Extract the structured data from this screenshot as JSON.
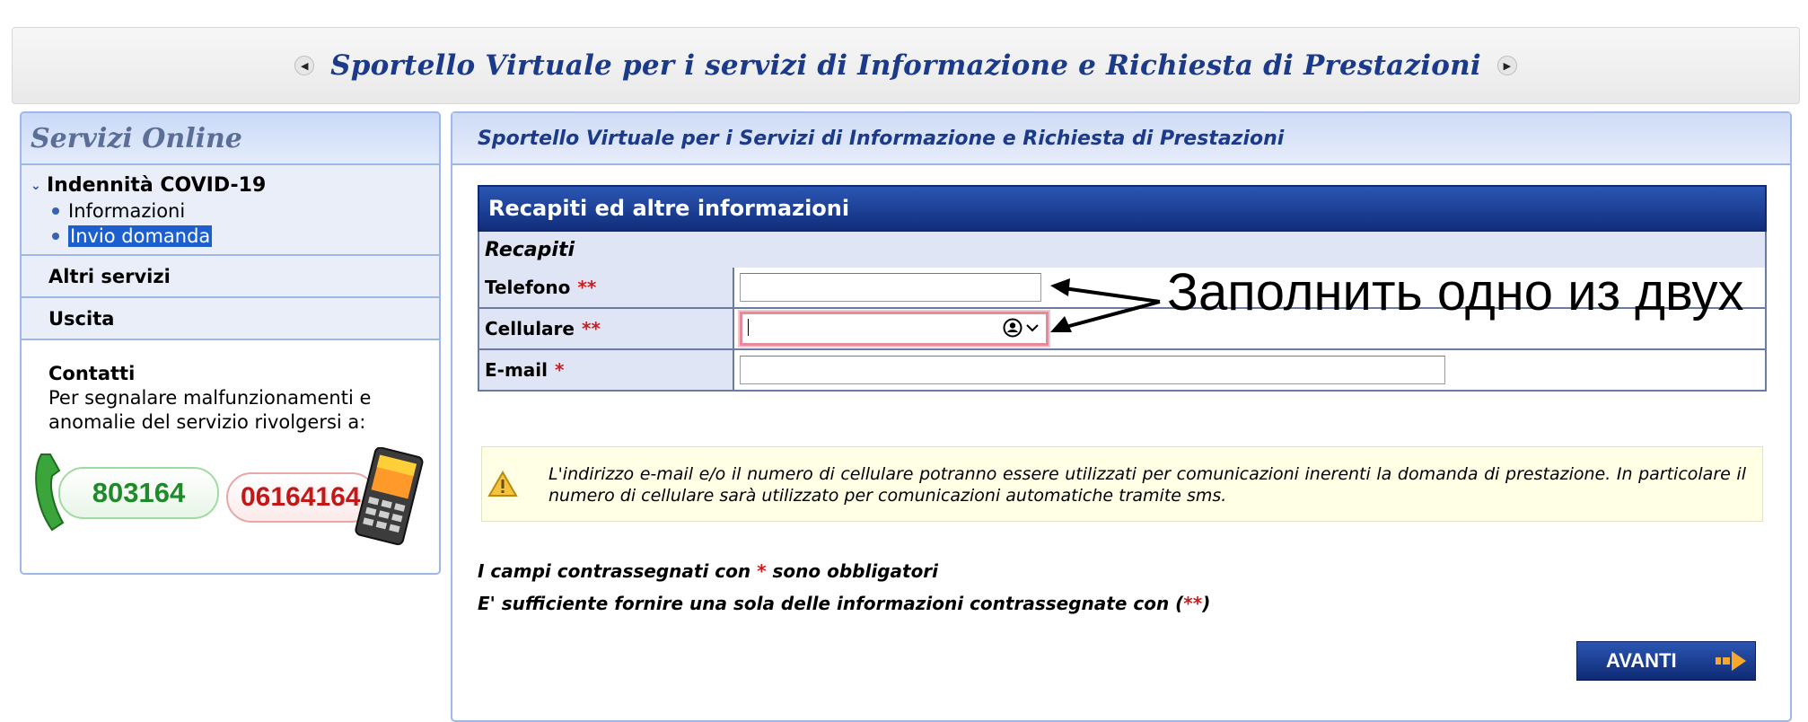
{
  "header": {
    "title": "Sportello Virtuale per i servizi di Informazione e Richiesta di Prestazioni",
    "prev_icon": "chevron-left-icon",
    "next_icon": "chevron-right-icon"
  },
  "sidebar": {
    "title": "Servizi Online",
    "group": {
      "label": "Indennità COVID-19",
      "items": [
        {
          "label": "Informazioni",
          "selected": false
        },
        {
          "label": "Invio domanda",
          "selected": true
        }
      ]
    },
    "links": [
      "Altri servizi",
      "Uscita"
    ],
    "contacts": {
      "title": "Contatti",
      "text": "Per segnalare malfunzionamenti e anomalie del servizio rivolgersi a:",
      "phone_green": "803164",
      "phone_red": "06164164"
    }
  },
  "main": {
    "header": "Sportello Virtuale per i Servizi di Informazione e Richiesta di Prestazioni",
    "form": {
      "title": "Recapiti ed altre informazioni",
      "section": "Recapiti",
      "fields": [
        {
          "label": "Telefono",
          "required": "**",
          "value": ""
        },
        {
          "label": "Cellulare",
          "required": "**",
          "value": ""
        },
        {
          "label": "E-mail",
          "required": "*",
          "value": ""
        }
      ]
    },
    "annotation": "Заполнить одно из двух",
    "note": "L'indirizzo e-mail e/o il numero di cellulare potranno essere utilizzati per comunicazioni inerenti la domanda di prestazione. In particolare il numero di cellulare sarà utilizzato per comunicazioni automatiche tramite sms.",
    "legend1": {
      "before": "I campi contrassegnati con ",
      "mark": "*",
      "after": " sono obbligatori"
    },
    "legend2": {
      "before": "E' sufficiente fornire una sola delle informazioni contrassegnate con (",
      "mark": "**",
      "after": ")"
    },
    "next_button": "AVANTI"
  },
  "colors": {
    "brand": "#1c3a8a",
    "accent_border": "#9db7e8",
    "required": "#d21a1a"
  }
}
